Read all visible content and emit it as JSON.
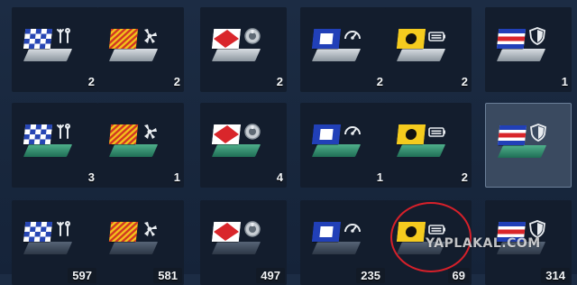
{
  "rows": [
    {
      "base": "grey",
      "items": [
        {
          "flag": "blue-checker",
          "emblem": "wrench-icon",
          "count": "2"
        },
        {
          "flag": "red-yellow-diagonal",
          "emblem": "propeller-icon",
          "count": "2"
        },
        {
          "flag": "red-diamond",
          "emblem": "gear-medal-icon",
          "count": "2"
        },
        {
          "flag": "blue-square",
          "emblem": "gauge-icon",
          "count": "2"
        },
        {
          "flag": "yellow-dot",
          "emblem": "battery-icon",
          "count": "2"
        },
        {
          "flag": "blue-red-stripes",
          "emblem": "shield-icon",
          "count": "1"
        }
      ]
    },
    {
      "base": "green",
      "items": [
        {
          "flag": "blue-checker",
          "emblem": "wrench-icon",
          "count": "3"
        },
        {
          "flag": "red-yellow-diagonal",
          "emblem": "propeller-icon",
          "count": "1"
        },
        {
          "flag": "red-diamond",
          "emblem": "gear-medal-icon",
          "count": "4"
        },
        {
          "flag": "blue-square",
          "emblem": "gauge-icon",
          "count": "1"
        },
        {
          "flag": "yellow-dot",
          "emblem": "battery-icon",
          "count": "2"
        },
        {
          "flag": "blue-red-stripes",
          "emblem": "shield-icon",
          "count": "",
          "selected": true
        }
      ]
    },
    {
      "base": "dark",
      "items": [
        {
          "flag": "blue-checker",
          "emblem": "wrench-icon",
          "count": "597"
        },
        {
          "flag": "red-yellow-diagonal",
          "emblem": "propeller-icon",
          "count": "581"
        },
        {
          "flag": "red-diamond",
          "emblem": "gear-medal-icon",
          "count": "497"
        },
        {
          "flag": "blue-square",
          "emblem": "gauge-icon",
          "count": "235"
        },
        {
          "flag": "yellow-dot",
          "emblem": "battery-icon",
          "count": "69"
        },
        {
          "flag": "blue-red-stripes",
          "emblem": "shield-icon",
          "count": "314"
        }
      ]
    }
  ],
  "watermark": "YAPLAKAL.COM",
  "colors": {
    "background": "#18273d",
    "tile": "#131d2d",
    "tile_selected": "#3a4a60",
    "highlight_circle": "#d6202a"
  }
}
